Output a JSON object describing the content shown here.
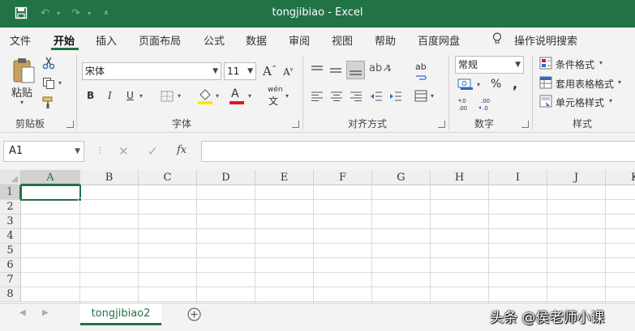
{
  "title_bar": {
    "title": "tongjibiao  -  Excel"
  },
  "quick_access": {
    "save_icon": "save-icon",
    "undo_icon": "undo-icon",
    "redo_icon": "redo-icon",
    "customize_icon": "customize-quick-access-icon"
  },
  "menu": {
    "items": [
      "文件",
      "开始",
      "插入",
      "页面布局",
      "公式",
      "数据",
      "审阅",
      "视图",
      "帮助",
      "百度网盘"
    ],
    "active": "开始",
    "tell_me": "操作说明搜索"
  },
  "ribbon": {
    "clipboard": {
      "paste": "粘贴",
      "label": "剪贴板"
    },
    "font": {
      "name": "宋体",
      "size": "11",
      "bold": "B",
      "italic": "I",
      "underline": "U",
      "phonetic": "wén",
      "grow": "A",
      "shrink": "A",
      "color_letter": "A",
      "fill_color": "#ffe600",
      "font_color": "#e81123",
      "label": "字体"
    },
    "alignment": {
      "label": "对齐方式",
      "wrap": "ab"
    },
    "number": {
      "format": "常规",
      "percent": "%",
      "comma": ",",
      "label": "数字"
    },
    "styles": {
      "conditional": "条件格式",
      "table": "套用表格格式",
      "cell": "单元格样式",
      "label": "样式"
    }
  },
  "formula_bar": {
    "name_box": "A1",
    "fx": "fx",
    "formula": ""
  },
  "grid": {
    "columns": [
      "A",
      "B",
      "C",
      "D",
      "E",
      "F",
      "G",
      "H",
      "I",
      "J",
      "K"
    ],
    "rows": [
      "1",
      "2",
      "3",
      "4",
      "5",
      "6",
      "7",
      "8"
    ],
    "selected_cell": "A1"
  },
  "sheet_tabs": {
    "tabs": [
      "tongjibiao2"
    ],
    "active": "tongjibiao2"
  },
  "watermark": "头条 @侯老师小课",
  "colors": {
    "accent": "#217346"
  }
}
